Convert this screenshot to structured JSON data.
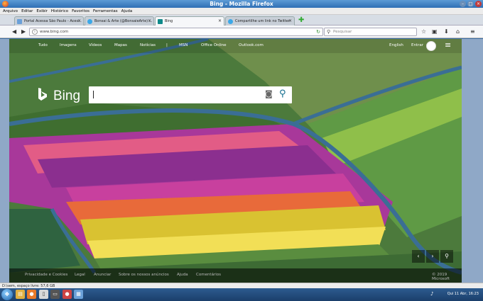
{
  "window": {
    "title": "Bing - Mozilla Firefox",
    "minimize": "–",
    "maximize": "□",
    "close": "×"
  },
  "menubar": {
    "items": [
      "Arquivo",
      "Editar",
      "Exibir",
      "Histórico",
      "Favoritos",
      "Ferramentas",
      "Ajuda"
    ]
  },
  "tabs": [
    {
      "label": "Portal Acessa São Paulo - Aces...",
      "close": "×"
    },
    {
      "label": "Bonsai & Arte (@BonsaieArte) ...",
      "close": "×"
    },
    {
      "label": "Bing",
      "close": "×"
    },
    {
      "label": "Compartilhe um link no Twitter",
      "close": "×"
    }
  ],
  "newtab": "✚",
  "navbar": {
    "url": "www.bing.com",
    "search_placeholder": "Pesquisar"
  },
  "bing": {
    "logo_text": "Bing",
    "nav_items": [
      "Tudo",
      "Imagens",
      "Vídeos",
      "Mapas",
      "Notícias",
      "|",
      "MSN",
      "Office Online",
      "Outlook.com"
    ],
    "language": "English",
    "signin": "Entrar",
    "footer_links": [
      "Privacidade e Cookies",
      "Legal",
      "Anunciar",
      "Sobre os nossos anúncios",
      "Ajuda",
      "Comentários"
    ],
    "copyright": "© 2019 Microsoft",
    "carousel": {
      "prev": "‹",
      "next": "›",
      "location": "⚲"
    }
  },
  "statusbar": {
    "text": "D:\\sem, espaço livre: 57,6 GB"
  },
  "taskbar": {
    "clock": "Qui 11 Abr, 16:23"
  },
  "colors": {
    "titlebar": "#2f6fb5",
    "accent": "#3b6ea5"
  }
}
